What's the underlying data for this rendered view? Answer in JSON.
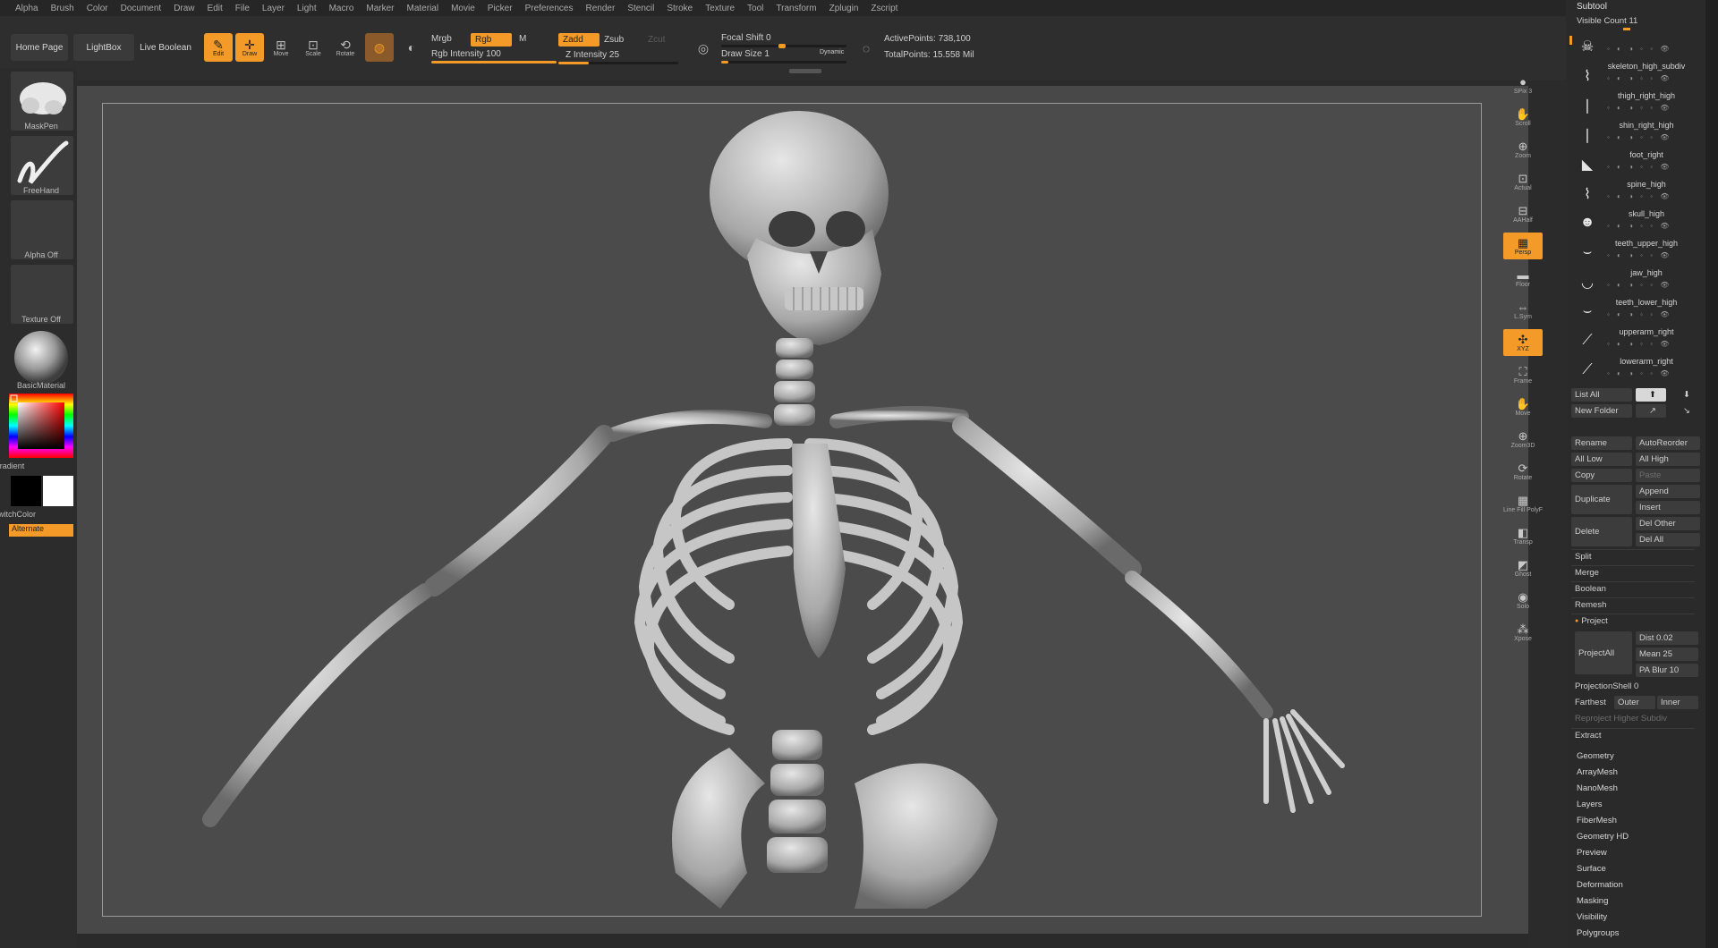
{
  "menubar": [
    "Alpha",
    "Brush",
    "Color",
    "Document",
    "Draw",
    "Edit",
    "File",
    "Layer",
    "Light",
    "Macro",
    "Marker",
    "Material",
    "Movie",
    "Picker",
    "Preferences",
    "Render",
    "Stencil",
    "Stroke",
    "Texture",
    "Tool",
    "Transform",
    "Zplugin",
    "Zscript"
  ],
  "shelf": {
    "home_page": "Home Page",
    "lightbox": "LightBox",
    "live_boolean": "Live Boolean",
    "tools": [
      {
        "label": "Edit",
        "active": true
      },
      {
        "label": "Draw",
        "active": true
      },
      {
        "label": "Move",
        "active": false
      },
      {
        "label": "Scale",
        "active": false
      },
      {
        "label": "Rotate",
        "active": false
      }
    ],
    "mrgb": "Mrgb",
    "rgb": "Rgb",
    "m": "M",
    "rgb_intensity_label": "Rgb Intensity",
    "rgb_intensity_value": "100",
    "rgb_intensity_fraction": 1.0,
    "zadd": "Zadd",
    "zsub": "Zsub",
    "zcut": "Zcut",
    "z_intensity_label": "Z Intensity",
    "z_intensity_value": "25",
    "z_intensity_fraction": 0.25,
    "focal_shift_label": "Focal Shift",
    "focal_shift_value": "0",
    "draw_size_label": "Draw Size",
    "draw_size_value": "1",
    "dynamic": "Dynamic",
    "active_points_label": "ActivePoints:",
    "active_points_value": "738,100",
    "total_points_label": "TotalPoints:",
    "total_points_value": "15.558 Mil"
  },
  "left": {
    "brush": "MaskPen",
    "stroke": "FreeHand",
    "alpha": "Alpha Off",
    "texture": "Texture Off",
    "material": "BasicMaterial",
    "gradient": "Gradient",
    "switch_color": "SwitchColor",
    "alternate": "Alternate"
  },
  "righttool": [
    {
      "label": "SPix 3",
      "icon": "spix-icon",
      "active": false
    },
    {
      "label": "Scroll",
      "icon": "scroll-icon",
      "active": false
    },
    {
      "label": "Zoom",
      "icon": "zoom-icon",
      "active": false
    },
    {
      "label": "Actual",
      "icon": "actual-icon",
      "active": false
    },
    {
      "label": "AAHalf",
      "icon": "aahalf-icon",
      "active": false
    },
    {
      "label": "Persp",
      "icon": "persp-icon",
      "active": true
    },
    {
      "label": "Floor",
      "icon": "floor-icon",
      "active": false
    },
    {
      "label": "L.Sym",
      "icon": "lsym-icon",
      "active": false
    },
    {
      "label": "XYZ",
      "icon": "xyz-icon",
      "active": true
    },
    {
      "label": "Frame",
      "icon": "frame-icon",
      "active": false
    },
    {
      "label": "Move",
      "icon": "move-icon",
      "active": false
    },
    {
      "label": "Zoom3D",
      "icon": "zoom3d-icon",
      "active": false
    },
    {
      "label": "Rotate",
      "icon": "rotate-icon",
      "active": false
    },
    {
      "label": "Line Fill PolyF",
      "icon": "polyf-icon",
      "active": false
    },
    {
      "label": "Transp",
      "icon": "transp-icon",
      "active": false
    },
    {
      "label": "Ghost",
      "icon": "ghost-icon",
      "active": false
    },
    {
      "label": "Solo",
      "icon": "solo-icon",
      "active": false
    },
    {
      "label": "Xpose",
      "icon": "xpose-icon",
      "active": false
    }
  ],
  "subtool": {
    "title": "Subtool",
    "visible_count_label": "Visible Count",
    "visible_count_value": "11",
    "items": [
      {
        "name": "",
        "glyph": "☠"
      },
      {
        "name": "skeleton_high_subdiv",
        "glyph": "⌇"
      },
      {
        "name": "thigh_right_high",
        "glyph": "❘"
      },
      {
        "name": "shin_right_high",
        "glyph": "❘"
      },
      {
        "name": "foot_right",
        "glyph": "◣"
      },
      {
        "name": "spine_high",
        "glyph": "⌇"
      },
      {
        "name": "skull_high",
        "glyph": "☻"
      },
      {
        "name": "teeth_upper_high",
        "glyph": "⌣"
      },
      {
        "name": "jaw_high",
        "glyph": "◡"
      },
      {
        "name": "teeth_lower_high",
        "glyph": "⌣"
      },
      {
        "name": "upperarm_right",
        "glyph": "⟋"
      },
      {
        "name": "lowerarm_right",
        "glyph": "⟋"
      }
    ],
    "list_all": "List All",
    "new_folder": "New Folder",
    "rename": "Rename",
    "autoreorder": "AutoReorder",
    "all_low": "All Low",
    "all_high": "All High",
    "copy": "Copy",
    "paste": "Paste",
    "duplicate": "Duplicate",
    "append": "Append",
    "insert": "Insert",
    "delete": "Delete",
    "del_other": "Del Other",
    "del_all": "Del All",
    "split": "Split",
    "merge": "Merge",
    "boolean": "Boolean",
    "remesh": "Remesh",
    "project": "Project",
    "project_all": "ProjectAll",
    "dist_label": "Dist",
    "dist_value": "0.02",
    "mean_label": "Mean",
    "mean_value": "25",
    "pa_blur_label": "PA Blur",
    "pa_blur_value": "10",
    "projection_shell_label": "ProjectionShell",
    "projection_shell_value": "0",
    "farthest": "Farthest",
    "outer": "Outer",
    "inner": "Inner",
    "reproject": "Reproject Higher Subdiv",
    "extract": "Extract"
  },
  "tool_menu": [
    "Geometry",
    "ArrayMesh",
    "NanoMesh",
    "Layers",
    "FiberMesh",
    "Geometry HD",
    "Preview",
    "Surface",
    "Deformation",
    "Masking",
    "Visibility",
    "Polygroups"
  ],
  "colors": {
    "accent": "#f39a28",
    "bg": "#2b2b2b",
    "canvas": "#4b4b4b"
  }
}
